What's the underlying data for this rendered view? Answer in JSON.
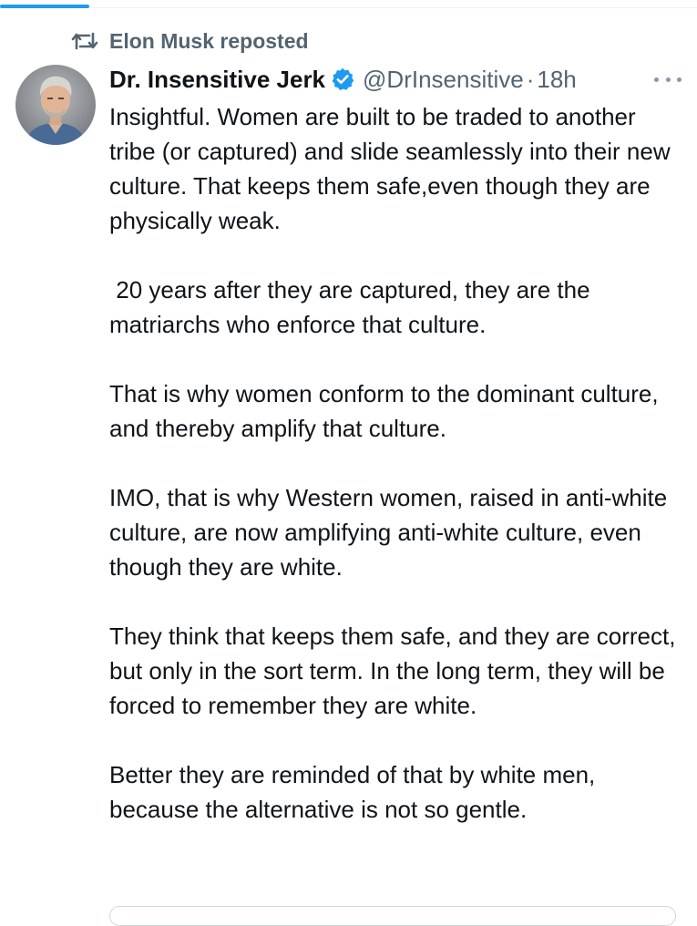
{
  "repost": {
    "label": "Elon Musk reposted",
    "icon": "repost-icon"
  },
  "author": {
    "name": "Dr. Insensitive Jerk",
    "handle": "@DrInsensitive",
    "separator": "·",
    "time": "18h",
    "verified_icon": "verified-badge-icon",
    "avatar_icon": "avatar-photo"
  },
  "more_icon": "more-options-icon",
  "tweet": {
    "paragraphs": [
      "Insightful. Women are built to be traded to another tribe (or captured) and slide seamlessly into their new culture. That keeps them safe,even though they are physically weak.",
      " 20 years after they are captured, they are the matriarchs who enforce that culture.",
      "That is why women conform to the dominant culture, and thereby amplify that culture.",
      "IMO, that is why Western women, raised in anti-white culture, are now amplifying anti-white culture, even though they are white.",
      "They think that keeps them safe, and they are correct, but only in the sort term. In the long term, they will be forced to remember they are white.",
      "Better they are reminded of that by white men, because the alternative is not so gentle."
    ]
  },
  "colors": {
    "accent": "#1d9bf0",
    "text_primary": "#0f1419",
    "text_secondary": "#536471"
  }
}
